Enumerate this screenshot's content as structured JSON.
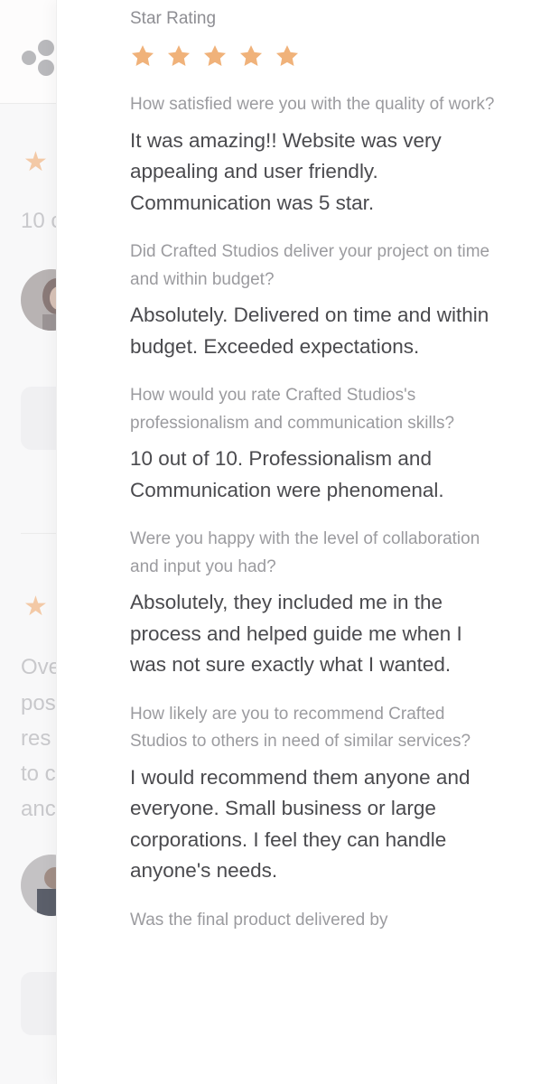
{
  "colors": {
    "star": "#f0b27a",
    "question_text": "#9b9b9f",
    "answer_text": "#4a4a4e",
    "background_star": "#f3c9a6"
  },
  "background_page": {
    "review_1": {
      "snippet": "10 c"
    },
    "review_2": {
      "snippet_lines": [
        "Ove",
        "pos",
        "res",
        "to c",
        "anc"
      ]
    }
  },
  "review": {
    "star_rating_label": "Star Rating",
    "rating": 5,
    "max_rating": 5,
    "questions": [
      {
        "question": "How satisfied were you with the quality of work?",
        "answer": "It was amazing!! Website was very appealing and user friendly. Communication was 5 star."
      },
      {
        "question": "Did Crafted Studios deliver your project on time and within budget?",
        "answer": "Absolutely. Delivered on time and within budget. Exceeded expectations."
      },
      {
        "question": "How would you rate Crafted Studios's professionalism and communication skills?",
        "answer": "10 out of 10. Professionalism and Communication were phenomenal."
      },
      {
        "question": "Were you happy with the level of collaboration and input you had?",
        "answer": "Absolutely, they included me in the process and helped guide me when I was not sure exactly what I wanted."
      },
      {
        "question": "How likely are you to recommend Crafted Studios to others in need of similar services?",
        "answer": "I would recommend them anyone and everyone. Small business or large corporations. I feel they can handle anyone's needs."
      },
      {
        "question": "Was the final product delivered by"
      }
    ]
  }
}
